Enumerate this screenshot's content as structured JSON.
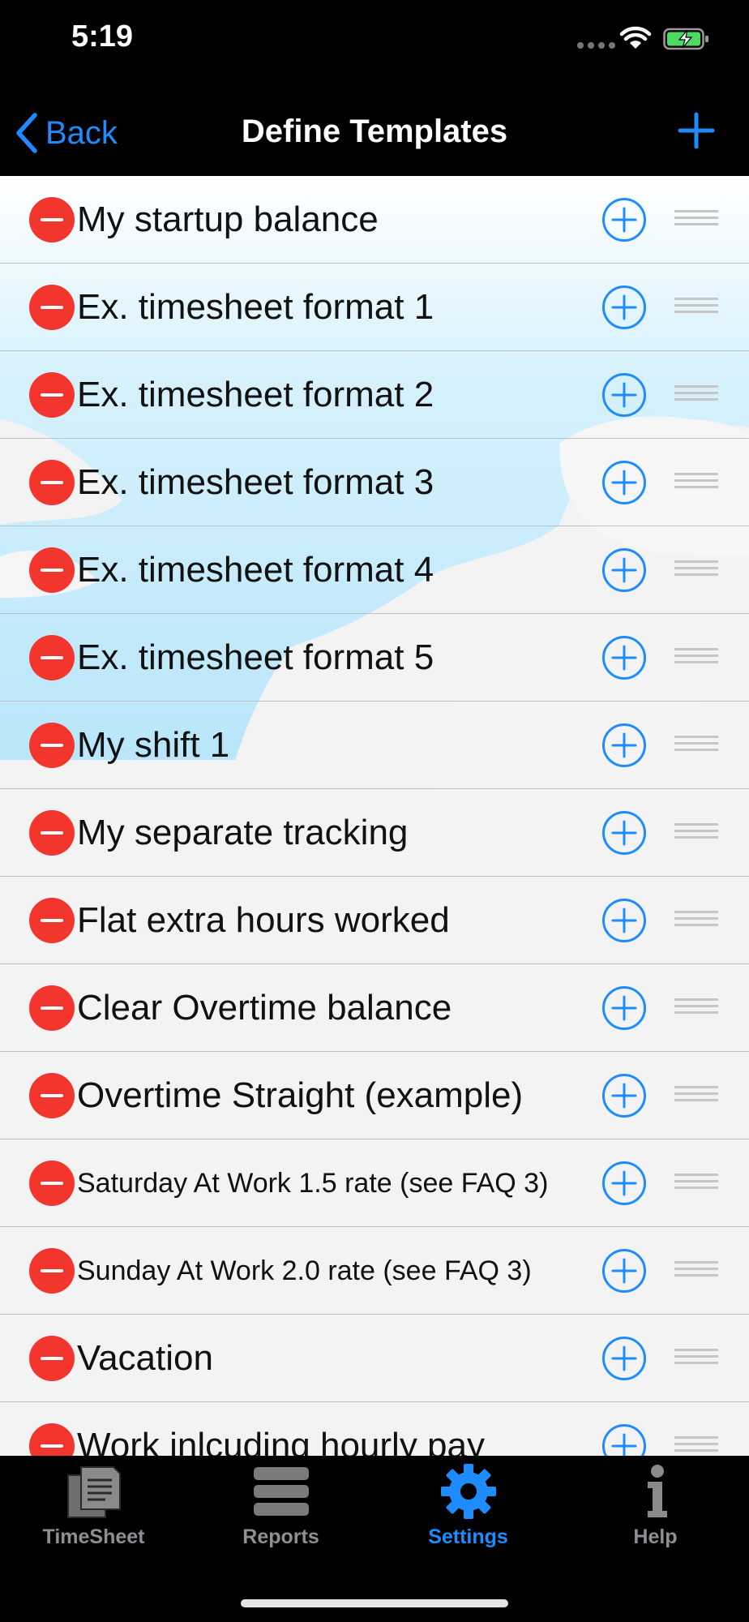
{
  "status": {
    "time": "5:19"
  },
  "nav": {
    "back_label": "Back",
    "title": "Define Templates"
  },
  "templates": [
    {
      "label": "My startup balance"
    },
    {
      "label": "Ex. timesheet format 1"
    },
    {
      "label": "Ex. timesheet format 2"
    },
    {
      "label": "Ex. timesheet format 3"
    },
    {
      "label": "Ex. timesheet format 4"
    },
    {
      "label": "Ex. timesheet format 5"
    },
    {
      "label": "My shift 1"
    },
    {
      "label": "My separate tracking"
    },
    {
      "label": "Flat extra hours worked"
    },
    {
      "label": "Clear Overtime balance"
    },
    {
      "label": "Overtime Straight (example)"
    },
    {
      "label": "Saturday At Work 1.5 rate (see FAQ  3)"
    },
    {
      "label": "Sunday At Work 2.0 rate (see FAQ  3)"
    },
    {
      "label": "Vacation"
    },
    {
      "label": "Work inlcuding hourly pay"
    }
  ],
  "tabs": [
    {
      "label": "TimeSheet",
      "icon": "timesheet-icon"
    },
    {
      "label": "Reports",
      "icon": "reports-icon"
    },
    {
      "label": "Settings",
      "icon": "gear-icon",
      "active": true
    },
    {
      "label": "Help",
      "icon": "info-icon"
    }
  ],
  "colors": {
    "accent": "#1e8cff",
    "delete": "#f2352d",
    "sky": "#bde8fb",
    "battery": "#4cd964"
  }
}
